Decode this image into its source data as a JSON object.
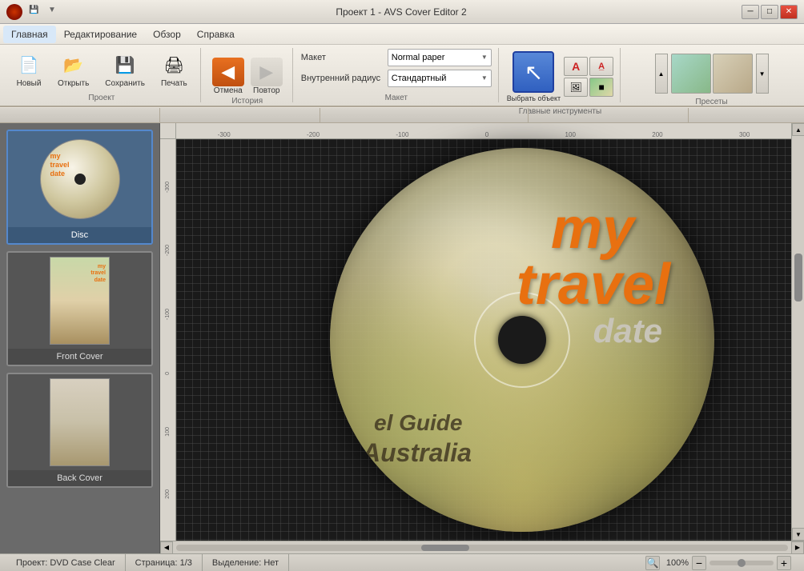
{
  "window": {
    "title": "Проект 1 - AVS Cover Editor 2",
    "min_btn": "─",
    "max_btn": "□",
    "close_btn": "✕"
  },
  "menu": {
    "items": [
      {
        "id": "home",
        "label": "Главная"
      },
      {
        "id": "edit",
        "label": "Редактирование"
      },
      {
        "id": "review",
        "label": "Обзор"
      },
      {
        "id": "help",
        "label": "Справка"
      }
    ]
  },
  "toolbar": {
    "project_section": {
      "label": "Проект",
      "buttons": [
        {
          "id": "new",
          "label": "Новый",
          "icon": "📄"
        },
        {
          "id": "open",
          "label": "Открыть",
          "icon": "📂"
        },
        {
          "id": "save",
          "label": "Сохранить",
          "icon": "💾"
        },
        {
          "id": "print",
          "label": "Печать",
          "icon": "🖨"
        }
      ]
    },
    "history_section": {
      "label": "История",
      "back_label": "Отмена",
      "forward_label": "Повтор"
    },
    "maket_section": {
      "label": "Макет",
      "layout_label": "Макет",
      "layout_value": "Normal paper",
      "radius_label": "Внутренний радиус",
      "radius_value": "Стандартный"
    },
    "tools_section": {
      "label": "Главные инструменты",
      "select_label": "Выбрать объект"
    },
    "presets_section": {
      "label": "Пресеты"
    }
  },
  "left_panel": {
    "items": [
      {
        "id": "disc",
        "label": "Disc",
        "active": true
      },
      {
        "id": "front-cover",
        "label": "Front Cover",
        "active": false
      },
      {
        "id": "back-cover",
        "label": "Back Cover",
        "active": false
      }
    ]
  },
  "canvas": {
    "disc_text": {
      "my": "my",
      "travel": "travel",
      "date": "date",
      "guide": "el Guide",
      "australia": "Australia"
    }
  },
  "ruler": {
    "top_marks": [
      "-300",
      "-200",
      "-100",
      "0",
      "100",
      "200",
      "300"
    ],
    "left_marks": [
      "-300",
      "-200",
      "-100",
      "0",
      "100",
      "200"
    ]
  },
  "status_bar": {
    "project": "Проект: DVD Case Clear",
    "page": "Страница: 1/3",
    "selection": "Выделение: Нет",
    "zoom": "100%"
  }
}
